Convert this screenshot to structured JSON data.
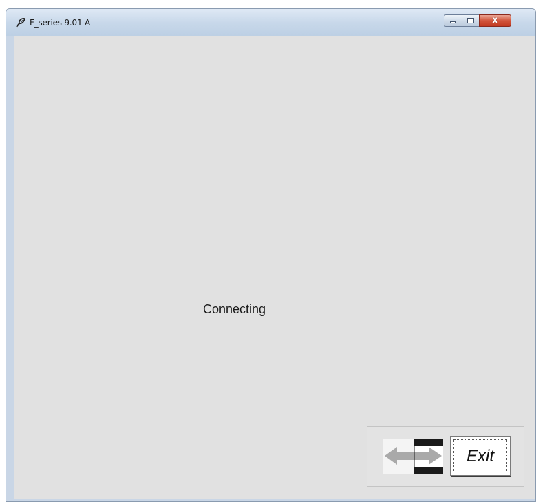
{
  "window": {
    "title": "F_series 9.01 A",
    "icon": "app-icon"
  },
  "title_controls": {
    "minimize_icon": "minimize-icon",
    "maximize_icon": "maximize-icon",
    "close_glyph": "x"
  },
  "main": {
    "status_text": "Connecting"
  },
  "nav_panel": {
    "swap_icon": "swap-arrows-icon",
    "exit_label": "Exit"
  },
  "colors": {
    "client_background": "#e1e1e1",
    "titlebar": "#c8d8ea",
    "close_button": "#c94a30"
  }
}
